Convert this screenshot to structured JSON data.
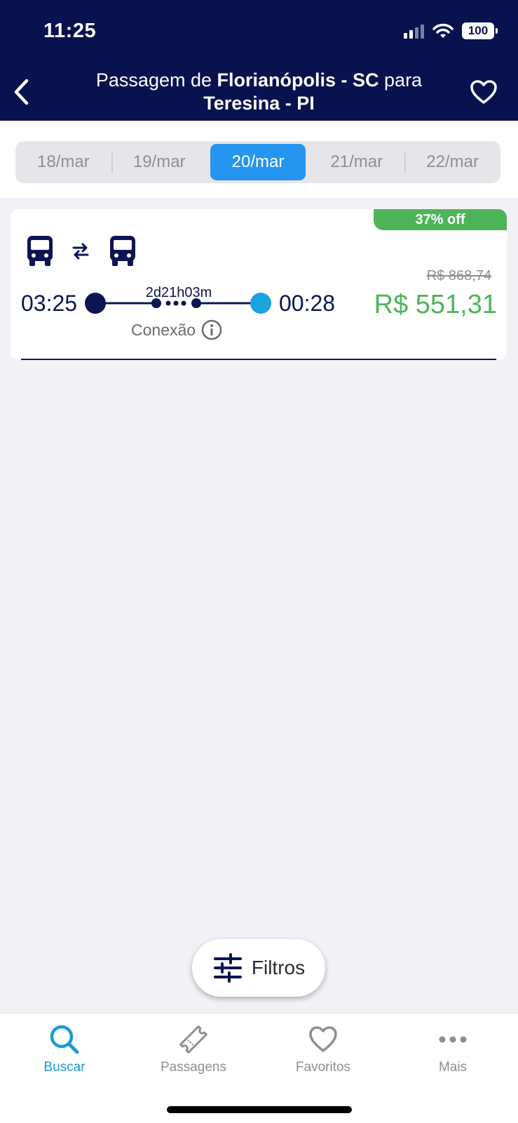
{
  "status_bar": {
    "time": "11:25",
    "battery": "100",
    "icons": [
      "signal-icon",
      "wifi-icon",
      "battery-icon"
    ]
  },
  "header": {
    "title_prefix": "Passagem de ",
    "origin": "Florianópolis - SC",
    "connector": " para",
    "destination": "Teresina - PI",
    "back_icon": "chevron-left-icon",
    "favorite_icon": "heart-outline-icon",
    "background_color": "#08124f"
  },
  "date_tabs": [
    {
      "label": "18/mar",
      "active": false
    },
    {
      "label": "19/mar",
      "active": false
    },
    {
      "label": "20/mar",
      "active": true
    },
    {
      "label": "21/mar",
      "active": false
    },
    {
      "label": "22/mar",
      "active": false
    }
  ],
  "trip": {
    "discount_badge": "37% off",
    "departure_time": "03:25",
    "arrival_time": "00:28",
    "duration": "2d21h03m",
    "connection_label": "Conexão",
    "old_price": "R$ 868,74",
    "new_price": "R$ 551,31",
    "icons": [
      "bus-icon",
      "swap-icon",
      "bus-icon",
      "info-icon"
    ],
    "price_color": "#4eb45a",
    "arrival_dot_color": "#1aa3e0"
  },
  "filter_button": {
    "label": "Filtros",
    "icon": "sliders-icon"
  },
  "bottom_nav": [
    {
      "label": "Buscar",
      "icon": "search-icon",
      "active": true
    },
    {
      "label": "Passagens",
      "icon": "ticket-icon",
      "active": false
    },
    {
      "label": "Favoritos",
      "icon": "heart-icon",
      "active": false
    },
    {
      "label": "Mais",
      "icon": "more-icon",
      "active": false
    }
  ],
  "accent_color": "#1a9ad6",
  "tab_active_color": "#2595f0"
}
